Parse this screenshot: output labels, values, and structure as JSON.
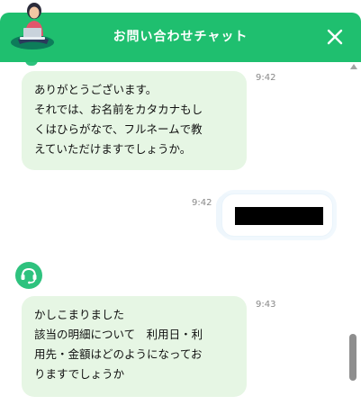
{
  "header": {
    "title": "お問い合わせチャット"
  },
  "icons": {
    "avatar": "operator-avatar-icon",
    "close": "close-icon",
    "bot": "headset-bot-icon"
  },
  "colors": {
    "brand_green": "#1fbf6f",
    "incoming_bubble": "#e6f6e4"
  },
  "messages": [
    {
      "direction": "incoming",
      "lines": [
        "ありがとうございます。",
        "それでは、お名前をカタカナもし",
        "くはひらがなで、フルネームで教",
        "えていただけますでしょうか。"
      ],
      "time": "9:42"
    },
    {
      "direction": "outgoing",
      "redacted": true,
      "time": "9:42"
    },
    {
      "direction": "incoming",
      "lines": [
        "かしこまりました",
        "該当の明細について　利用日・利",
        "用先・金額はどのようになってお",
        "りますでしょうか"
      ],
      "time": "9:43"
    }
  ]
}
